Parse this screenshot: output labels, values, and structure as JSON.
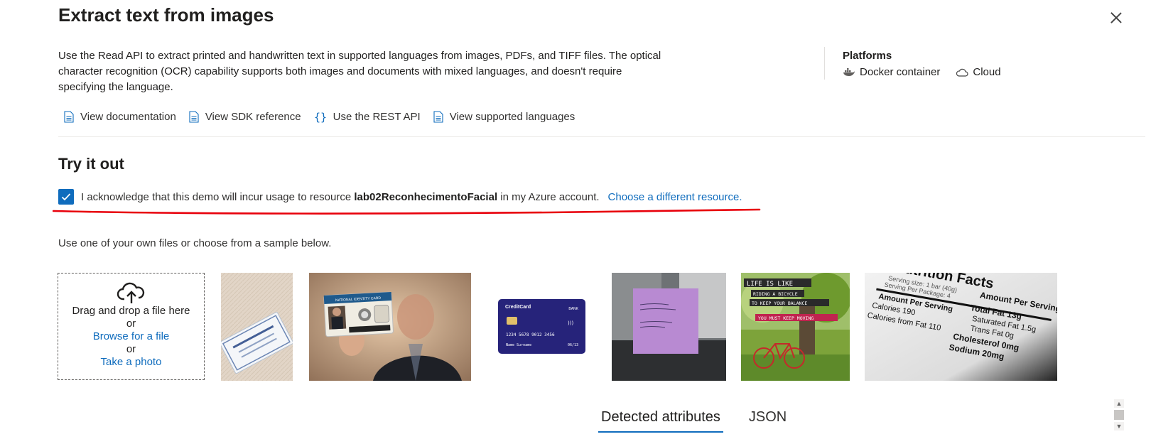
{
  "header": {
    "title": "Extract text from images"
  },
  "description": "Use the Read API to extract printed and handwritten text in supported languages from images, PDFs, and TIFF files. The optical character recognition (OCR) capability supports both images and documents with mixed languages, and doesn't require specifying the language.",
  "platforms": {
    "title": "Platforms",
    "items": [
      {
        "label": "Docker container",
        "icon": "docker-icon"
      },
      {
        "label": "Cloud",
        "icon": "cloud-icon"
      }
    ]
  },
  "links": [
    {
      "label": "View documentation",
      "icon": "document-icon"
    },
    {
      "label": "View SDK reference",
      "icon": "document-icon"
    },
    {
      "label": "Use the REST API",
      "icon": "braces-icon"
    },
    {
      "label": "View supported languages",
      "icon": "document-icon"
    }
  ],
  "try": {
    "title": "Try it out",
    "checked": true,
    "ack_prefix": "I acknowledge that this demo will incur usage to resource",
    "resource": "lab02ReconhecimentoFacial",
    "ack_suffix": "in my Azure account.",
    "choose_link": "Choose a different resource."
  },
  "samples": {
    "intro": "Use one of your own files or choose from a sample below.",
    "drop_line1": "Drag and drop a file here",
    "or1": "or",
    "browse": "Browse for a file",
    "or2": "or",
    "photo": "Take a photo",
    "card_brand": "CreditCard",
    "card_bank": "BANK",
    "card_number": "1234 5678 9012 3456",
    "card_name": "Name Surname",
    "card_exp": "06/13",
    "id_card_label": "NATIONAL IDENTITY CARD",
    "poster_lines": [
      "LIFE IS LIKE",
      "RIDING A BICYCLE",
      "TO KEEP YOUR BALANCE",
      "YOU MUST KEEP MOVING"
    ],
    "nutrition": {
      "title": "Nutrition Facts",
      "serving": "Serving size: 1 bar (40g)",
      "per_package": "Serving Per Package: 4",
      "amount": "Amount Per Serving",
      "calories": "Calories 190",
      "fat_cal": "Calories from Fat 110",
      "total_fat": "Total Fat 13g",
      "sat_fat": "Saturated Fat 1.5g",
      "trans_fat": "Trans Fat 0g",
      "cholesterol": "Cholesterol 0mg",
      "sodium": "Sodium 20mg"
    }
  },
  "tabs": [
    {
      "label": "Detected attributes",
      "active": true
    },
    {
      "label": "JSON",
      "active": false
    }
  ],
  "colors": {
    "accent": "#0f6cbd",
    "annotation": "#e8000b"
  }
}
